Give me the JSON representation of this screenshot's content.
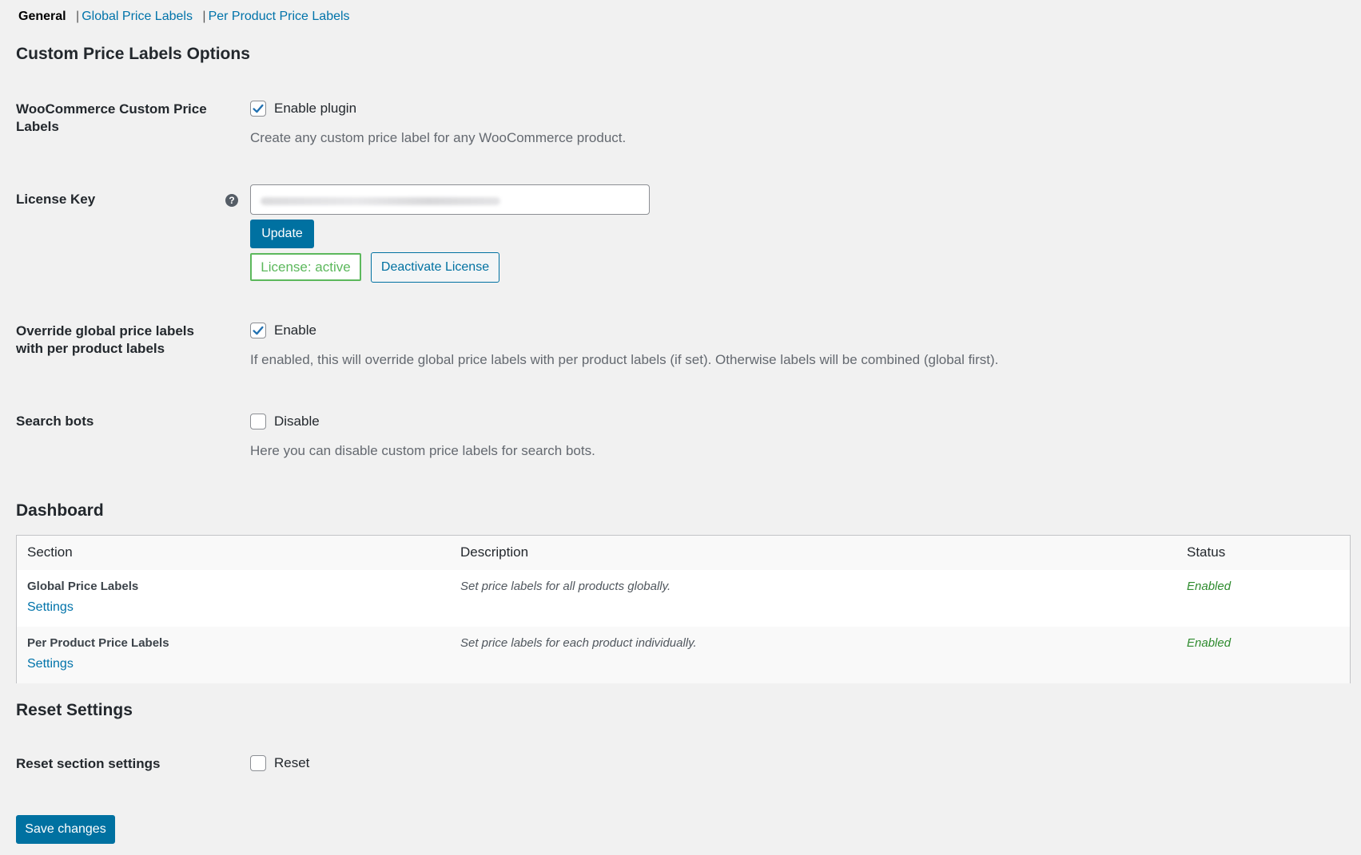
{
  "subnav": {
    "current": "General",
    "links": [
      "Global Price Labels",
      "Per Product Price Labels"
    ]
  },
  "headings": {
    "options": "Custom Price Labels Options",
    "dashboard": "Dashboard",
    "reset": "Reset Settings"
  },
  "fields": {
    "plugin": {
      "label": "WooCommerce Custom Price Labels",
      "checkbox_label": "Enable plugin",
      "checked": true,
      "description": "Create any custom price label for any WooCommerce product."
    },
    "license": {
      "label": "License Key",
      "help_icon": "help-circle-icon",
      "update_label": "Update",
      "status_label": "License: active",
      "deactivate_label": "Deactivate License"
    },
    "override": {
      "label": "Override global price labels with per product labels",
      "checkbox_label": "Enable",
      "checked": true,
      "description": "If enabled, this will override global price labels with per product labels (if set). Otherwise labels will be combined (global first)."
    },
    "bots": {
      "label": "Search bots",
      "checkbox_label": "Disable",
      "checked": false,
      "description": "Here you can disable custom price labels for search bots."
    },
    "reset": {
      "label": "Reset section settings",
      "checkbox_label": "Reset",
      "checked": false
    }
  },
  "dashboard_table": {
    "headers": [
      "Section",
      "Description",
      "Status"
    ],
    "rows": [
      {
        "section": "Global Price Labels",
        "link": "Settings",
        "description": "Set price labels for all products globally.",
        "status": "Enabled"
      },
      {
        "section": "Per Product Price Labels",
        "link": "Settings",
        "description": "Set price labels for each product individually.",
        "status": "Enabled"
      }
    ]
  },
  "save_label": "Save changes",
  "colors": {
    "primary": "#0071a1",
    "link": "#0073aa",
    "active_green": "#5cb85c",
    "status_green": "#2e8b2e",
    "background": "#f1f1f1"
  }
}
